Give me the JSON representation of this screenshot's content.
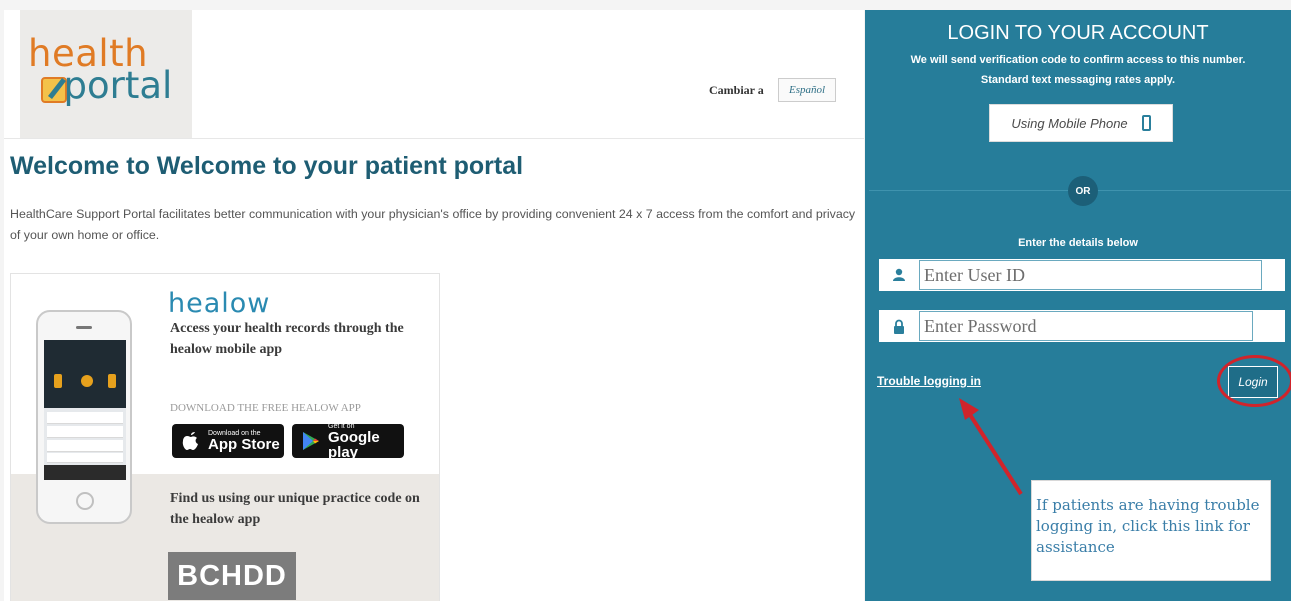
{
  "logo": {
    "line1": "health",
    "line2": "portal"
  },
  "language": {
    "label": "Cambiar a",
    "button": "Español"
  },
  "welcome": {
    "title": "Welcome to Welcome to your patient portal",
    "description": "HealthCare Support Portal facilitates better communication with your physician's office by providing convenient 24 x 7 access from the comfort and privacy of your own home or office."
  },
  "healow": {
    "logo": "healow",
    "tagline": "Access your health records through the healow mobile app",
    "download_label": "DOWNLOAD THE FREE HEALOW APP",
    "appstore_small": "Download on the",
    "appstore_big": "App Store",
    "googleplay_small": "Get it on",
    "googleplay_big": "Google play",
    "find_text": "Find us using our unique practice code on the healow app",
    "practice_code": "BCHDD"
  },
  "login": {
    "title": "LOGIN TO YOUR ACCOUNT",
    "subtitle_1": "We will send verification code to confirm access to this number.",
    "subtitle_2": "Standard text messaging rates apply.",
    "mobile_button": "Using Mobile Phone",
    "or_label": "OR",
    "details_label": "Enter the details below",
    "userid_placeholder": "Enter User ID",
    "password_placeholder": "Enter Password",
    "trouble_link": "Trouble logging in",
    "login_button": "Login"
  },
  "annotation": {
    "note": "If patients are having trouble logging in, click this link for assistance",
    "arrow_color": "#d0242b",
    "circle_color": "#d0242b"
  },
  "icons": [
    "pencil-icon",
    "apple-icon",
    "google-play-icon",
    "mobile-phone-icon",
    "user-icon",
    "lock-icon"
  ],
  "colors": {
    "panel": "#267d9a",
    "title": "#1e5d73",
    "accent_orange": "#e07b25"
  }
}
